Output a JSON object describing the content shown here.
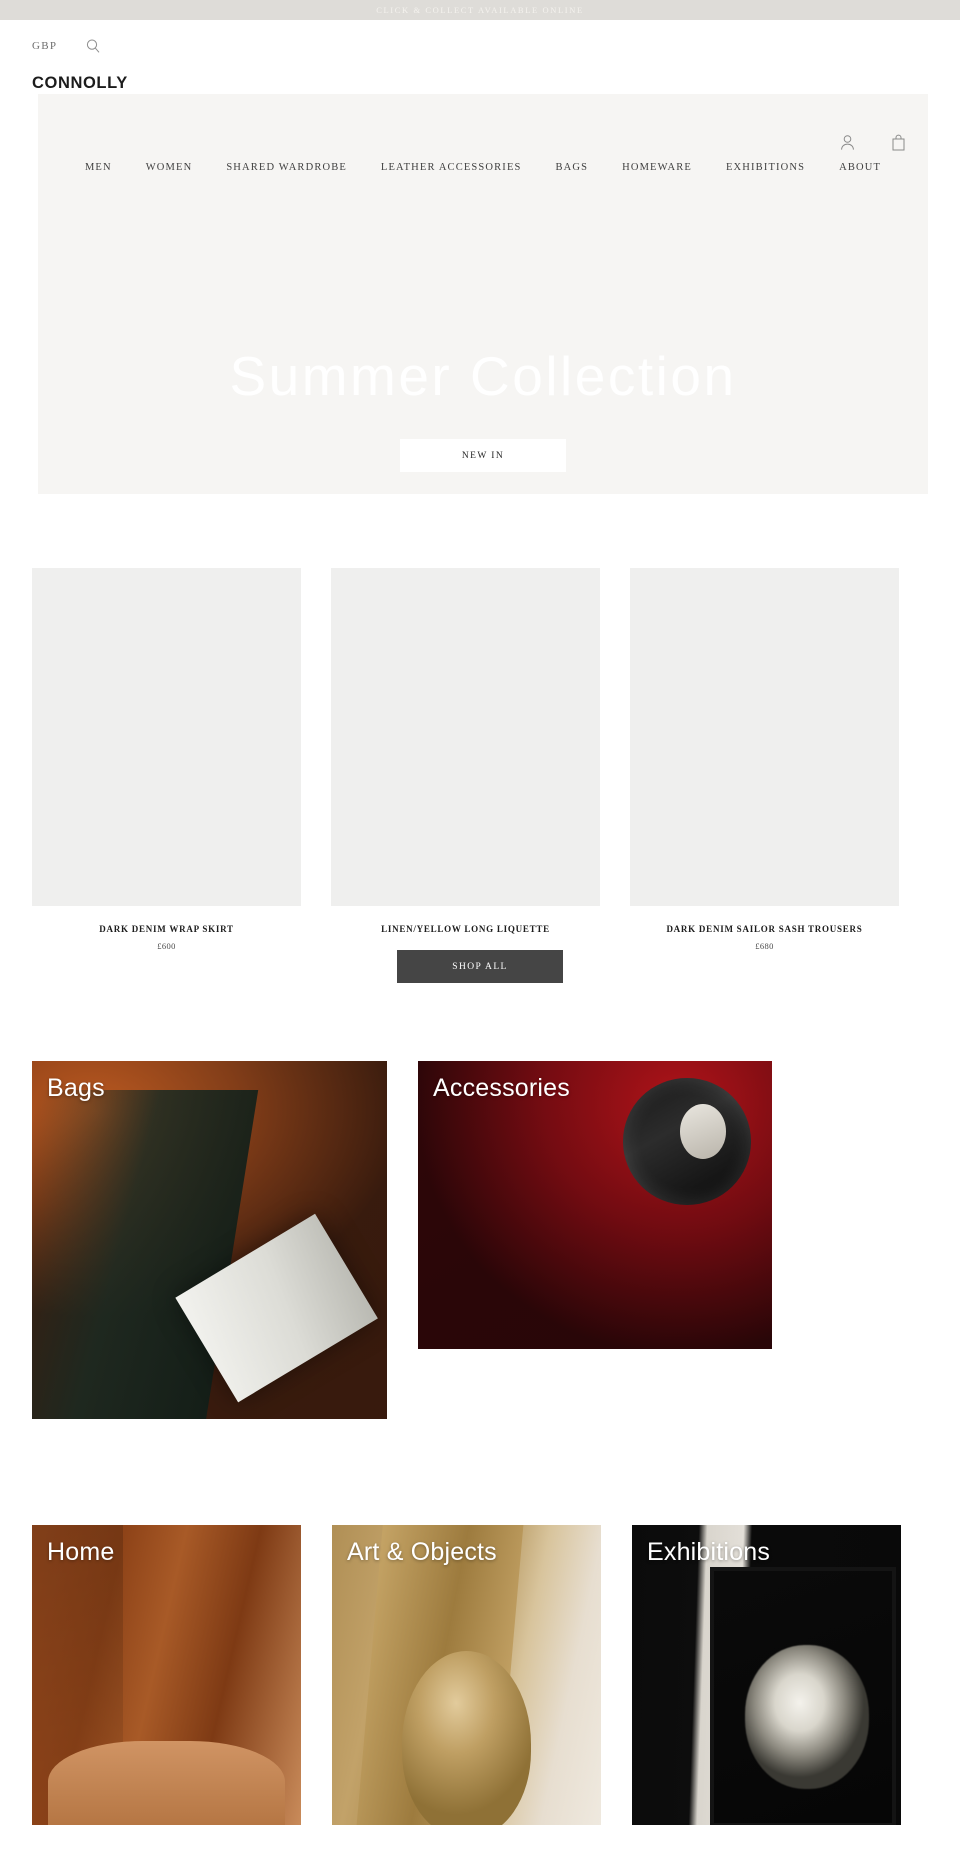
{
  "announcement": {
    "text": "CLICK & COLLECT AVAILABLE ONLINE"
  },
  "utility": {
    "currency": "GBP",
    "search_icon": "search-icon"
  },
  "brand": {
    "logo": "CONNOLLY"
  },
  "header": {
    "account_icon": "account-icon",
    "bag_icon": "shopping-bag-icon",
    "nav": [
      {
        "label": "MEN"
      },
      {
        "label": "WOMEN"
      },
      {
        "label": "SHARED WARDROBE"
      },
      {
        "label": "LEATHER ACCESSORIES"
      },
      {
        "label": "BAGS"
      },
      {
        "label": "HOMEWARE"
      },
      {
        "label": "EXHIBITIONS"
      },
      {
        "label": "ABOUT"
      }
    ]
  },
  "hero": {
    "title": "Summer Collection",
    "cta_label": "NEW IN"
  },
  "products": {
    "shop_all_label": "SHOP ALL",
    "items": [
      {
        "name": "DARK DENIM WRAP SKIRT",
        "price": "£600"
      },
      {
        "name": "LINEN/YELLOW LONG LIQUETTE",
        "price": ""
      },
      {
        "name": "DARK DENIM SAILOR SASH TROUSERS",
        "price": "£680"
      }
    ]
  },
  "categories": {
    "row_one": [
      {
        "label": "Bags"
      },
      {
        "label": "Accessories"
      }
    ],
    "row_two": [
      {
        "label": "Home"
      },
      {
        "label": "Art & Objects"
      },
      {
        "label": "Exhibitions"
      }
    ]
  },
  "colors": {
    "announcement_bg": "#dedcd8",
    "hero_bg": "#f6f5f3",
    "product_placeholder": "#efefee",
    "shop_all_bg": "#454545",
    "text_dark": "#1c1c1c"
  }
}
